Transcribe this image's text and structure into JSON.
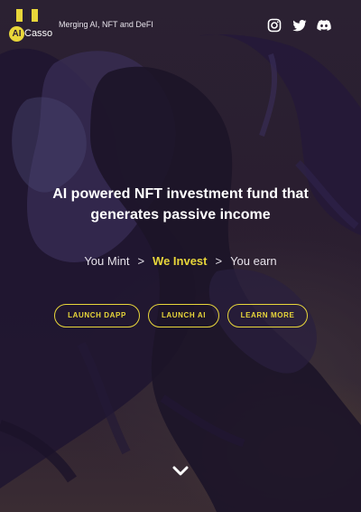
{
  "brand": {
    "logo_badge": "AI",
    "logo_name": "Casso",
    "tagline": "Merging AI, NFT and DeFI"
  },
  "social": [
    {
      "icon": "instagram-icon"
    },
    {
      "icon": "twitter-icon"
    },
    {
      "icon": "discord-icon"
    }
  ],
  "hero": {
    "title_line1": "AI powered NFT investment fund that",
    "title_line2": "generates passive income",
    "steps": [
      "You Mint",
      "We Invest",
      "You earn"
    ],
    "step_separator": ">",
    "active_step_index": 1
  },
  "buttons": {
    "launch_dapp": "LAUNCH DAPP",
    "launch_ai": "LAUNCH AI",
    "learn_more": "LEARN MORE"
  },
  "scroll": {
    "icon": "chevron-down-icon"
  },
  "colors": {
    "accent": "#e8d63a",
    "background": "#2a1d33",
    "text": "#ffffff"
  }
}
